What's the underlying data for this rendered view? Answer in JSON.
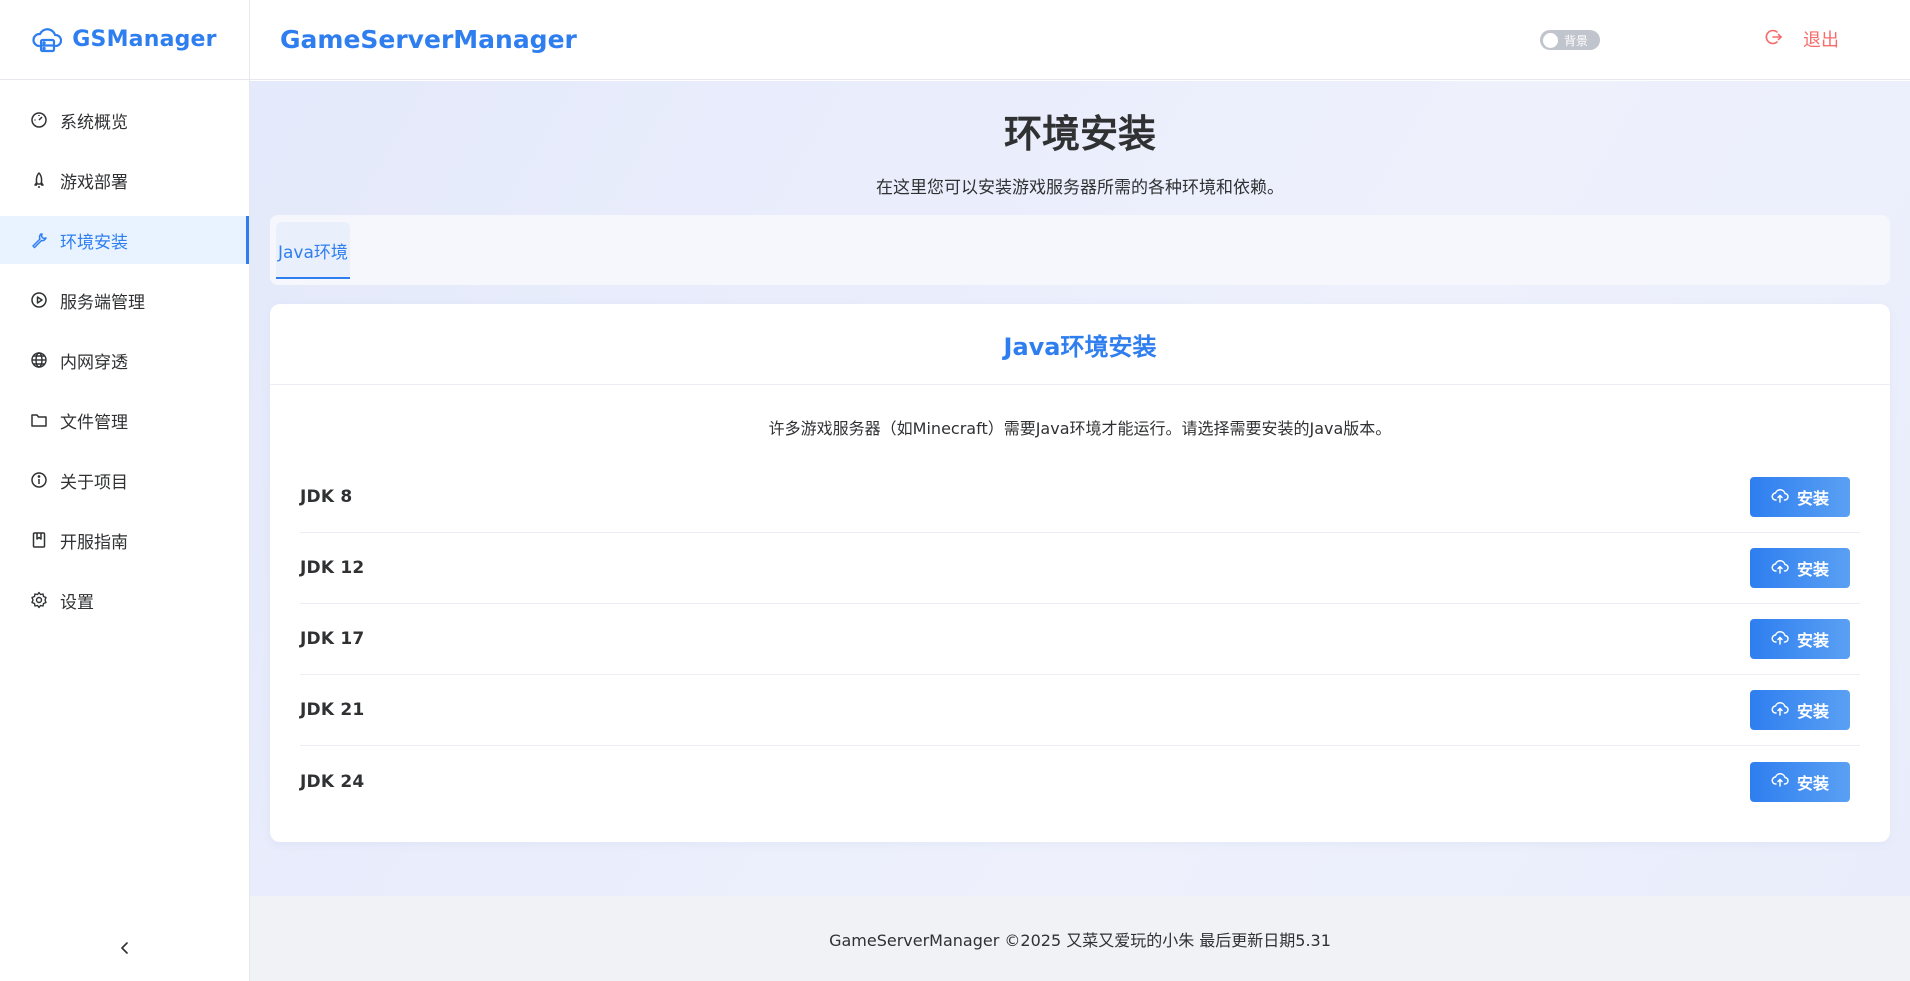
{
  "brand": {
    "logo_text": "GSManager",
    "accent": "#2e7ef0"
  },
  "sidebar": {
    "items": [
      {
        "label": "系统概览",
        "icon": "dashboard-icon"
      },
      {
        "label": "游戏部署",
        "icon": "rocket-icon"
      },
      {
        "label": "环境安装",
        "icon": "wrench-icon"
      },
      {
        "label": "服务端管理",
        "icon": "play-circle-icon"
      },
      {
        "label": "内网穿透",
        "icon": "globe-icon"
      },
      {
        "label": "文件管理",
        "icon": "folder-icon"
      },
      {
        "label": "关于项目",
        "icon": "info-icon"
      },
      {
        "label": "开服指南",
        "icon": "book-icon"
      },
      {
        "label": "设置",
        "icon": "gear-icon"
      }
    ],
    "active_index": 2,
    "collapse_icon": "chevron-left-icon"
  },
  "header": {
    "title": "GameServerManager",
    "bg_toggle_label": "背景",
    "logout_label": "退出",
    "logout_color": "#f56c6c"
  },
  "main": {
    "page_title": "环境安装",
    "page_desc": "在这里您可以安装游戏服务器所需的各种环境和依赖。",
    "tabs": [
      {
        "label": "Java环境"
      }
    ],
    "card": {
      "title": "Java环境安装",
      "desc": "许多游戏服务器（如Minecraft）需要Java环境才能运行。请选择需要安装的Java版本。",
      "jdks": [
        {
          "name": "JDK 8",
          "button": "安装"
        },
        {
          "name": "JDK 12",
          "button": "安装"
        },
        {
          "name": "JDK 17",
          "button": "安装"
        },
        {
          "name": "JDK 21",
          "button": "安装"
        },
        {
          "name": "JDK 24",
          "button": "安装"
        }
      ]
    }
  },
  "footer": {
    "text": "GameServerManager ©2025 又菜又爱玩的小朱 最后更新日期5.31"
  }
}
